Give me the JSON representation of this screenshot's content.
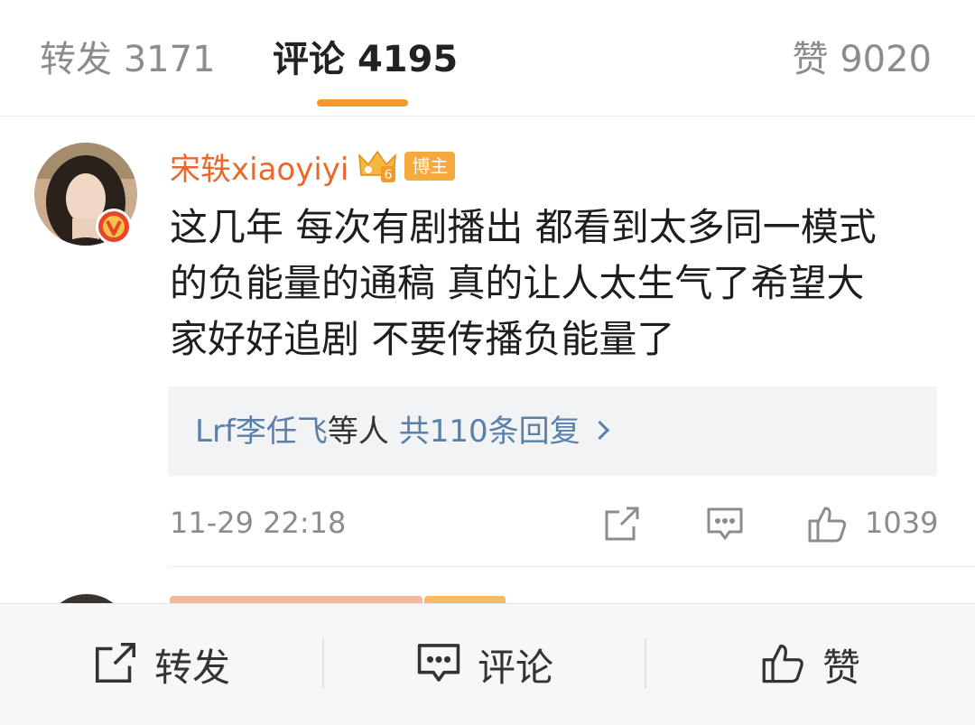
{
  "tabs": {
    "repost": {
      "label": "转发",
      "count": "3171"
    },
    "comments": {
      "label": "评论",
      "count": "4195"
    },
    "likes": {
      "label": "赞",
      "count": "9020"
    }
  },
  "comment": {
    "username": "宋轶xiaoyiyi",
    "level_badge": "6",
    "role_badge": "博主",
    "text_lines": [
      "这几年 每次有剧播出 都看到太多同一模式",
      "的负能量的通稿 真的让人太生气了希望大",
      "家好好追剧 不要传播负能量了"
    ],
    "replies": {
      "names": "Lrf李任飞",
      "suffix": "等人",
      "total": "共110条回复"
    },
    "timestamp": "11-29 22:18",
    "like_count": "1039"
  },
  "bottom_bar": {
    "repost": "转发",
    "comment": "评论",
    "like": "赞"
  },
  "icons": {
    "repost": "share-out-icon",
    "comment": "comment-bubble-icon",
    "like": "thumbs-up-icon",
    "verified": "verified-v-icon",
    "crown": "crown-level-icon"
  },
  "colors": {
    "accent_orange": "#f39a2b",
    "username_orange": "#e86a2a",
    "link_blue": "#5b7fa8",
    "badge_orange": "#f6a93d",
    "verified_red": "#e8452b"
  }
}
